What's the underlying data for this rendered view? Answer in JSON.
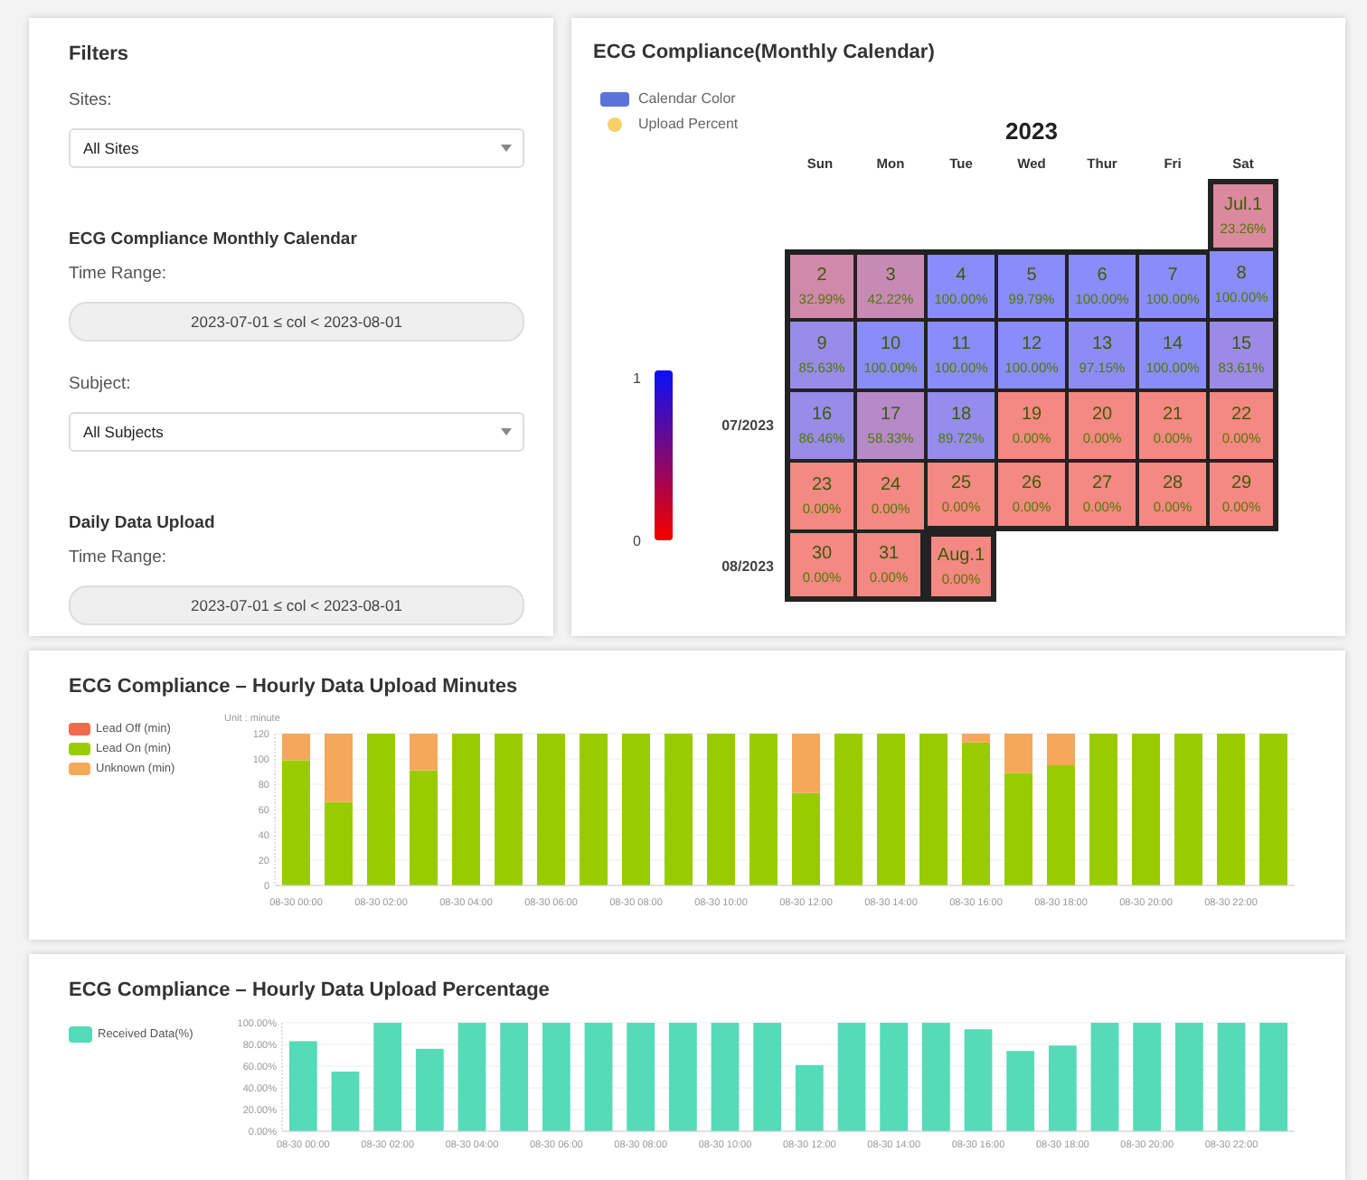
{
  "filters": {
    "title": "Filters",
    "sites": {
      "label": "Sites:",
      "value": "All Sites"
    },
    "calendar_section": {
      "title": "ECG Compliance Monthly Calendar",
      "time_label": "Time Range:",
      "range": "2023-07-01 ≤ col < 2023-08-01"
    },
    "subject": {
      "label": "Subject:",
      "value": "All Subjects"
    },
    "upload_section": {
      "title": "Daily Data Upload",
      "time_label": "Time Range:",
      "range": "2023-07-01 ≤ col < 2023-08-01"
    }
  },
  "calendar": {
    "title": "ECG Compliance(Monthly Calendar)",
    "legend": [
      {
        "label": "Calendar Color",
        "kind": "swatch",
        "color": "#5b72d8"
      },
      {
        "label": "Upload Percent",
        "kind": "dot",
        "color": "#f7d06b"
      }
    ],
    "year": "2023",
    "scale_max": "1",
    "scale_min": "0",
    "weekdays": [
      "Sun",
      "Mon",
      "Tue",
      "Wed",
      "Thur",
      "Fri",
      "Sat"
    ],
    "weeks": [
      {
        "days": [
          {
            "day": "Jul.1",
            "percent": "23.26%",
            "color": "#db899e"
          }
        ]
      },
      {
        "days": [
          {
            "day": "2",
            "percent": "32.99%",
            "color": "#d189aa"
          },
          {
            "day": "3",
            "percent": "42.22%",
            "color": "#c78ab5"
          },
          {
            "day": "4",
            "percent": "100.00%",
            "color": "#8a8cfa"
          },
          {
            "day": "5",
            "percent": "99.79%",
            "color": "#8a8cfa"
          },
          {
            "day": "6",
            "percent": "100.00%",
            "color": "#8a8cfa"
          },
          {
            "day": "7",
            "percent": "100.00%",
            "color": "#8a8cfa"
          },
          {
            "day": "8",
            "percent": "100.00%",
            "color": "#8a8cfa"
          }
        ]
      },
      {
        "days": [
          {
            "day": "9",
            "percent": "85.63%",
            "color": "#998be9"
          },
          {
            "day": "10",
            "percent": "100.00%",
            "color": "#8a8cfa"
          },
          {
            "day": "11",
            "percent": "100.00%",
            "color": "#8a8cfa"
          },
          {
            "day": "12",
            "percent": "100.00%",
            "color": "#8a8cfa"
          },
          {
            "day": "13",
            "percent": "97.15%",
            "color": "#8d8cf7"
          },
          {
            "day": "14",
            "percent": "100.00%",
            "color": "#8a8cfa"
          },
          {
            "day": "15",
            "percent": "83.61%",
            "color": "#9b8be6"
          }
        ]
      },
      {
        "label": "07/2023",
        "days": [
          {
            "day": "16",
            "percent": "86.46%",
            "color": "#988bea"
          },
          {
            "day": "17",
            "percent": "58.33%",
            "color": "#b68ac8"
          },
          {
            "day": "18",
            "percent": "89.72%",
            "color": "#958cee"
          },
          {
            "day": "19",
            "percent": "0.00%",
            "color": "#f48882"
          },
          {
            "day": "20",
            "percent": "0.00%",
            "color": "#f48882"
          },
          {
            "day": "21",
            "percent": "0.00%",
            "color": "#f48882"
          },
          {
            "day": "22",
            "percent": "0.00%",
            "color": "#f48882"
          }
        ]
      },
      {
        "days": [
          {
            "day": "23",
            "percent": "0.00%",
            "color": "#f48882"
          },
          {
            "day": "24",
            "percent": "0.00%",
            "color": "#f48882"
          },
          {
            "day": "25",
            "percent": "0.00%",
            "color": "#f48882"
          },
          {
            "day": "26",
            "percent": "0.00%",
            "color": "#f48882"
          },
          {
            "day": "27",
            "percent": "0.00%",
            "color": "#f48882"
          },
          {
            "day": "28",
            "percent": "0.00%",
            "color": "#f48882"
          },
          {
            "day": "29",
            "percent": "0.00%",
            "color": "#f48882"
          }
        ]
      },
      {
        "label": "08/2023",
        "days": [
          {
            "day": "30",
            "percent": "0.00%",
            "color": "#f48882"
          },
          {
            "day": "31",
            "percent": "0.00%",
            "color": "#f48882"
          },
          {
            "day": "Aug.1",
            "percent": "0.00%",
            "color": "#f48882",
            "month_start": true
          }
        ]
      }
    ]
  },
  "minutes_panel": {
    "title": "ECG Compliance – Hourly Data Upload Minutes",
    "chart_data": {
      "type": "bar",
      "stacked": true,
      "grid": true,
      "ylabel": "Unit : minute",
      "categories": [
        "08-30 00:00",
        null,
        "08-30 02:00",
        null,
        "08-30 04:00",
        null,
        "08-30 06:00",
        null,
        "08-30 08:00",
        null,
        "08-30 10:00",
        null,
        "08-30 12:00",
        null,
        "08-30 14:00",
        null,
        "08-30 16:00",
        null,
        "08-30 18:00",
        null,
        "08-30 20:00",
        null,
        "08-30 22:00",
        null
      ],
      "series": [
        {
          "name": "Lead Off (min)",
          "color": "#f2694b",
          "values": [
            0,
            0,
            0,
            0,
            0,
            0,
            0,
            0,
            0,
            0,
            0,
            0,
            0,
            0,
            0,
            0,
            0,
            0,
            0,
            0,
            0,
            0,
            0,
            0
          ]
        },
        {
          "name": "Lead On (min)",
          "color": "#99cc00",
          "values": [
            99,
            66,
            120,
            91,
            120,
            120,
            120,
            120,
            120,
            120,
            120,
            120,
            73,
            120,
            120,
            120,
            113,
            89,
            95,
            120,
            120,
            120,
            120,
            120
          ]
        },
        {
          "name": "Unknown (min)",
          "color": "#f5a85a",
          "values": [
            21,
            54,
            0,
            29,
            0,
            0,
            0,
            0,
            0,
            0,
            0,
            0,
            47,
            0,
            0,
            0,
            7,
            31,
            25,
            0,
            0,
            0,
            0,
            0
          ]
        }
      ],
      "ylim": [
        0,
        120
      ],
      "yticks": [
        0,
        20,
        40,
        60,
        80,
        100,
        120
      ]
    }
  },
  "percent_panel": {
    "title": "ECG Compliance – Hourly Data Upload Percentage",
    "chart_data": {
      "type": "bar",
      "grid": true,
      "categories": [
        "08-30 00:00",
        null,
        "08-30 02:00",
        null,
        "08-30 04:00",
        null,
        "08-30 06:00",
        null,
        "08-30 08:00",
        null,
        "08-30 10:00",
        null,
        "08-30 12:00",
        null,
        "08-30 14:00",
        null,
        "08-30 16:00",
        null,
        "08-30 18:00",
        null,
        "08-30 20:00",
        null,
        "08-30 22:00",
        null
      ],
      "series": [
        {
          "name": "Received Data(%)",
          "color": "#55dbb8",
          "values": [
            83,
            55,
            100,
            76,
            100,
            100,
            100,
            100,
            100,
            100,
            100,
            100,
            61,
            100,
            100,
            100,
            94,
            74,
            79,
            100,
            100,
            100,
            100,
            100
          ]
        }
      ],
      "ylim": [
        0,
        100
      ],
      "yticks": [
        {
          "value": 0,
          "label": "0.00%"
        },
        {
          "value": 20,
          "label": "20.00%"
        },
        {
          "value": 40,
          "label": "40.00%"
        },
        {
          "value": 60,
          "label": "60.00%"
        },
        {
          "value": 80,
          "label": "80.00%"
        },
        {
          "value": 100,
          "label": "100.00%"
        }
      ]
    }
  }
}
